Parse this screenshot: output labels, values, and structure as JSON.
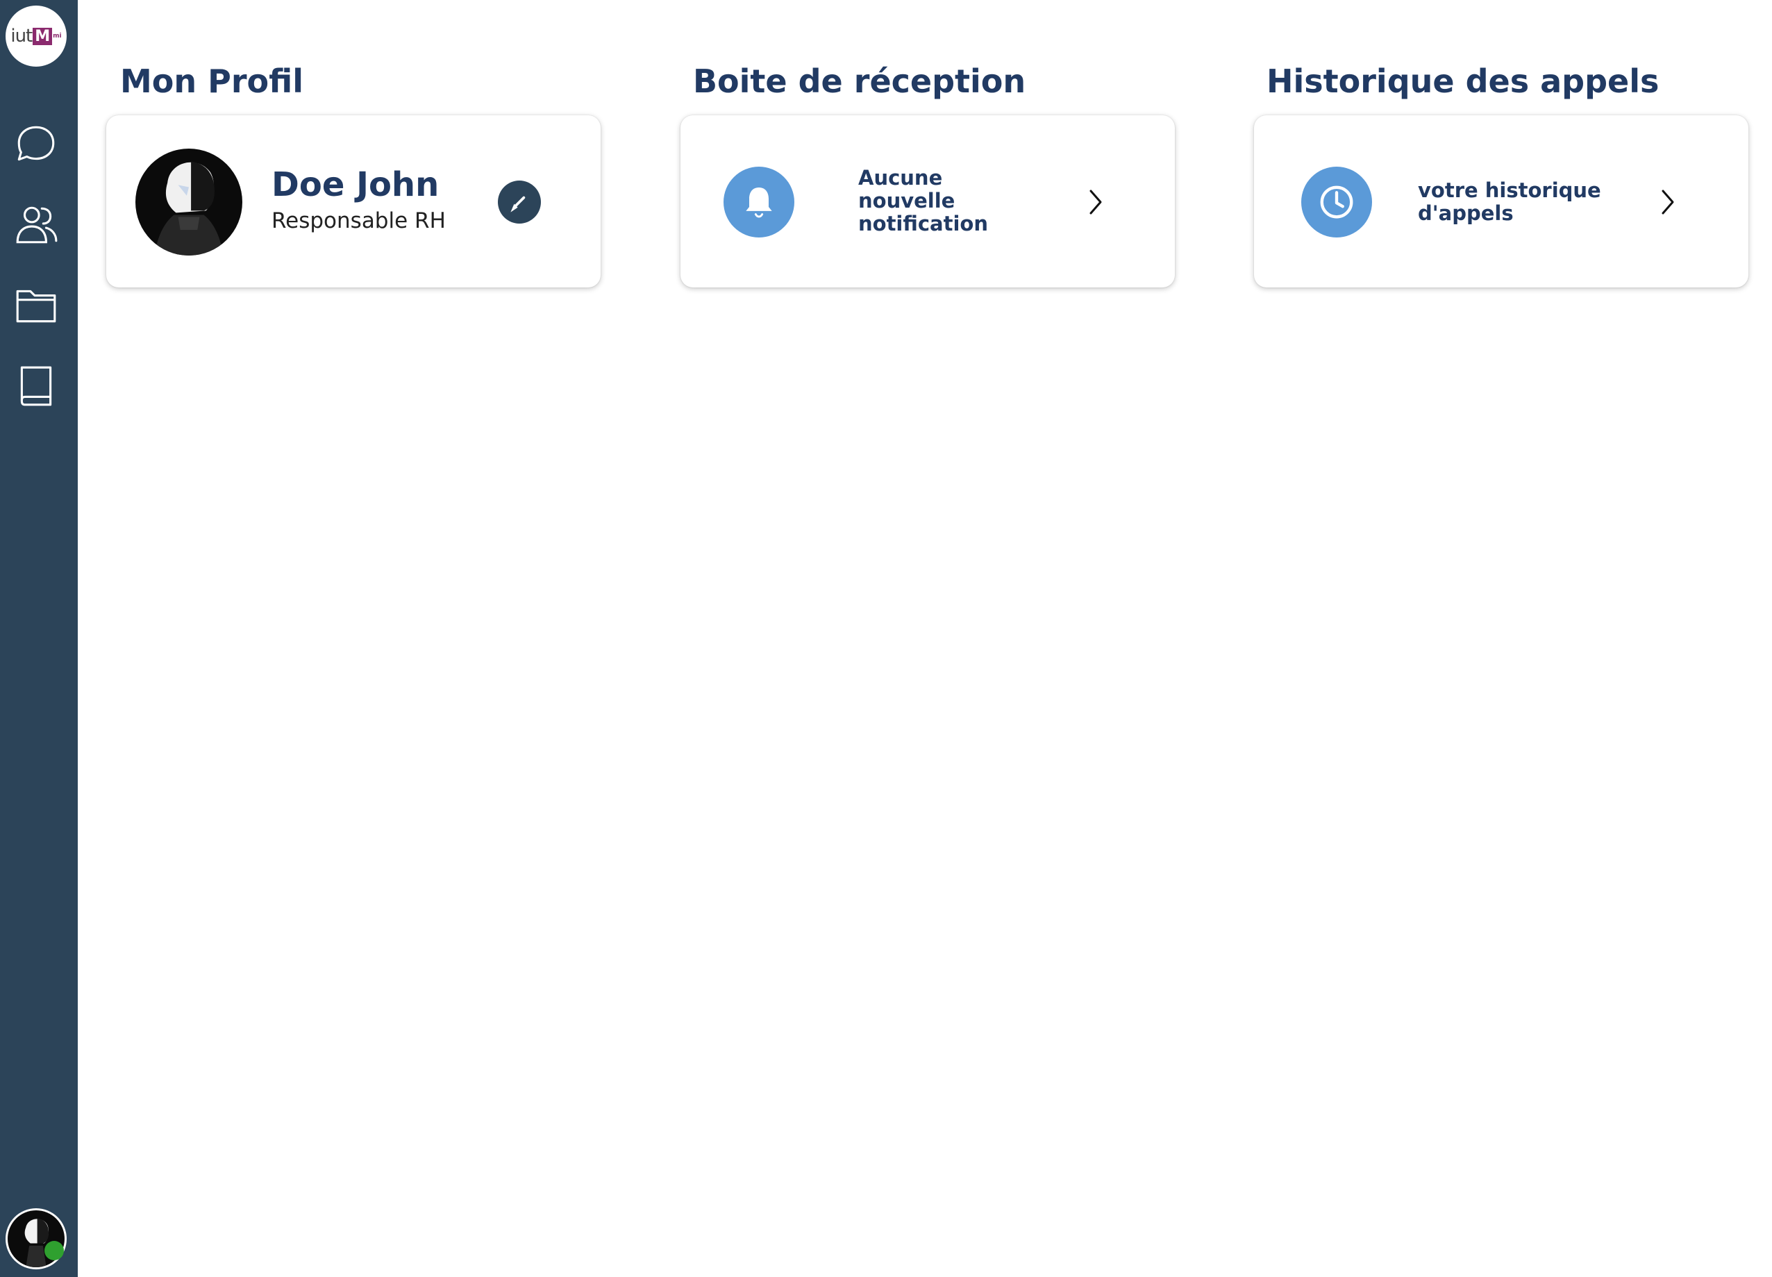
{
  "sidebar": {
    "logo": {
      "text": "iut",
      "mark": "M",
      "sub": "mi",
      "brand_color": "#8b2a6e"
    },
    "items": [
      {
        "name": "chat",
        "icon": "chat-bubble-icon"
      },
      {
        "name": "contacts",
        "icon": "users-icon"
      },
      {
        "name": "documents",
        "icon": "folder-icon"
      },
      {
        "name": "directory",
        "icon": "book-icon"
      }
    ],
    "status": "online",
    "background": "#2c4459"
  },
  "profile": {
    "title": "Mon Profil",
    "name": "Doe John",
    "role": "Responsable RH",
    "edit_icon": "pencil-icon"
  },
  "inbox": {
    "title": "Boite de réception",
    "message": "Aucune\nnouvelle\nnotification",
    "icon": "bell-icon"
  },
  "history": {
    "title": "Historique des appels",
    "message": "votre historique\nd'appels",
    "icon": "clock-icon"
  },
  "colors": {
    "heading": "#213a63",
    "accent": "#5b9ad8",
    "status_online": "#2fa02f"
  }
}
